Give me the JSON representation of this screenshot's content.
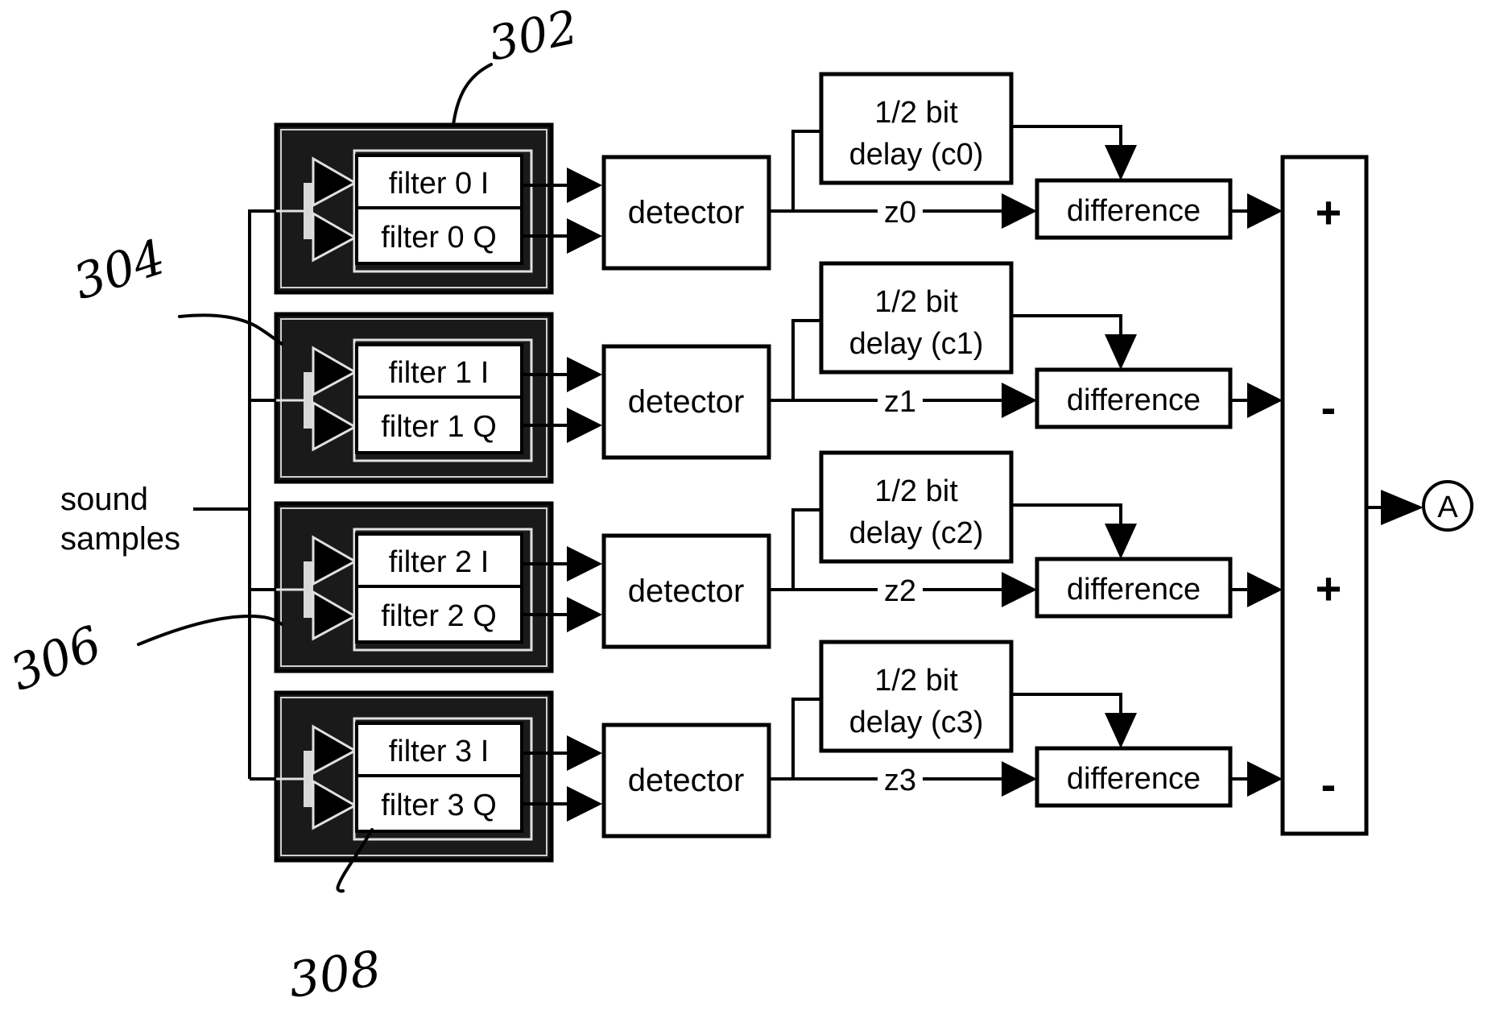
{
  "input": {
    "label_line1": "sound",
    "label_line2": "samples"
  },
  "channels": [
    {
      "filter_i": "filter 0 I",
      "filter_q": "filter 0 Q",
      "detector": "detector",
      "delay_line1": "1/2 bit",
      "delay_line2": "delay (c0)",
      "z_label": "z0",
      "difference": "difference",
      "sign": "+"
    },
    {
      "filter_i": "filter 1 I",
      "filter_q": "filter 1 Q",
      "detector": "detector",
      "delay_line1": "1/2 bit",
      "delay_line2": "delay (c1)",
      "z_label": "z1",
      "difference": "difference",
      "sign": "-"
    },
    {
      "filter_i": "filter 2 I",
      "filter_q": "filter 2 Q",
      "detector": "detector",
      "delay_line1": "1/2 bit",
      "delay_line2": "delay (c2)",
      "z_label": "z2",
      "difference": "difference",
      "sign": "+"
    },
    {
      "filter_i": "filter 3 I",
      "filter_q": "filter 3 Q",
      "detector": "detector",
      "delay_line1": "1/2 bit",
      "delay_line2": "delay (c3)",
      "z_label": "z3",
      "difference": "difference",
      "sign": "-"
    }
  ],
  "output": {
    "connector_label": "A"
  },
  "reference_numerals": {
    "filter_bank": "302",
    "bank_input": "304",
    "bank_splitter": "306",
    "bank_filters": "308"
  }
}
